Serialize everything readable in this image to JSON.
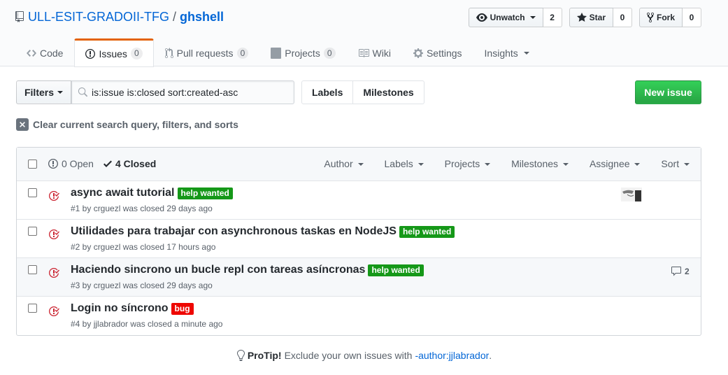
{
  "repo": {
    "owner": "ULL-ESIT-GRADOII-TFG",
    "separator": "/",
    "name": "ghshell"
  },
  "actions": {
    "watch_label": "Unwatch",
    "watch_count": "2",
    "star_label": "Star",
    "star_count": "0",
    "fork_label": "Fork",
    "fork_count": "0"
  },
  "nav": {
    "code": "Code",
    "issues": "Issues",
    "issues_count": "0",
    "pulls": "Pull requests",
    "pulls_count": "0",
    "projects": "Projects",
    "projects_count": "0",
    "wiki": "Wiki",
    "settings": "Settings",
    "insights": "Insights"
  },
  "subnav": {
    "filters": "Filters",
    "search_value": "is:issue is:closed sort:created-asc",
    "labels": "Labels",
    "milestones": "Milestones",
    "new_issue": "New issue"
  },
  "clear_query": "Clear current search query, filters, and sorts",
  "table_header": {
    "open": "0 Open",
    "closed": "4 Closed",
    "filters": [
      "Author",
      "Labels",
      "Projects",
      "Milestones",
      "Assignee",
      "Sort"
    ]
  },
  "issues": [
    {
      "title": "async await tutorial",
      "label": "help wanted",
      "meta": "#1 by crguezl was closed 29 days ago"
    },
    {
      "title": "Utilidades para trabajar con asynchronous taskas en NodeJS",
      "label": "help wanted",
      "meta": "#2 by crguezl was closed 17 hours ago"
    },
    {
      "title": "Haciendo sincrono un bucle repl con tareas asíncronas",
      "label": "help wanted",
      "meta": "#3 by crguezl was closed 29 days ago",
      "comments": "2"
    },
    {
      "title": "Login no síncrono",
      "label": "bug",
      "meta": "#4 by jjlabrador was closed a minute ago"
    }
  ],
  "protip": {
    "lead": "ProTip!",
    "text": "Exclude your own issues with",
    "link": "-author:jjlabrador",
    "end": "."
  },
  "colors": {
    "accent": "#0366d6",
    "green": "#28a745",
    "help_wanted": "#159818",
    "bug": "#ee0701",
    "closed_icon": "#cb2431"
  }
}
